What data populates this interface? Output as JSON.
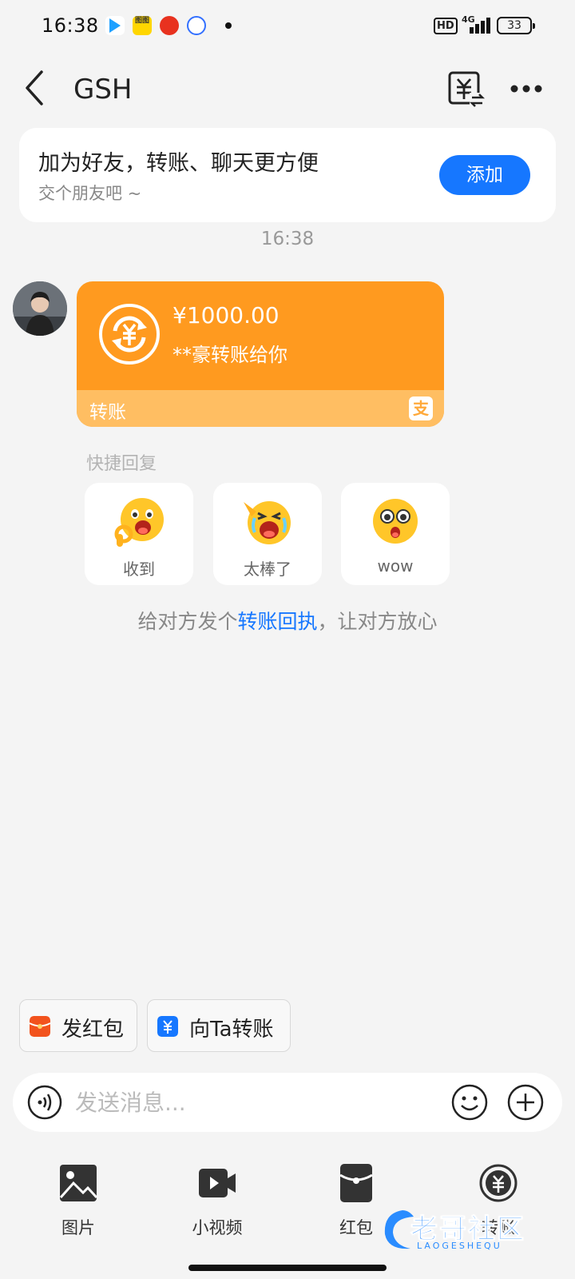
{
  "status_bar": {
    "time": "16:38",
    "notif_2_label": "图图",
    "hd": "HD",
    "network": "4G",
    "battery": "33"
  },
  "header": {
    "title": "GSH"
  },
  "add_friend": {
    "title": "加为好友，转账、聊天更方便",
    "subtitle": "交个朋友吧 ~",
    "button": "添加"
  },
  "chat": {
    "timestamp": "16:38",
    "transfer": {
      "amount": "¥1000.00",
      "description": "**豪转账给你",
      "footer_label": "转账",
      "brand_mark": "支",
      "card_color": "#ff9a1f"
    }
  },
  "quick_reply": {
    "label": "快捷回复",
    "items": [
      {
        "label": "收到",
        "icon": "ok-hand-emoji"
      },
      {
        "label": "太棒了",
        "icon": "cheer-emoji"
      },
      {
        "label": "wow",
        "icon": "wow-emoji"
      }
    ]
  },
  "receipt_tip": {
    "before": "给对方发个",
    "link": "转账回执",
    "after": "，让对方放心"
  },
  "shortcuts": {
    "red_packet": "发红包",
    "transfer": "向Ta转账"
  },
  "input": {
    "placeholder": "发送消息..."
  },
  "toolbar": {
    "items": [
      {
        "label": "图片",
        "icon": "image-icon"
      },
      {
        "label": "小视频",
        "icon": "video-icon"
      },
      {
        "label": "红包",
        "icon": "red-packet-icon"
      },
      {
        "label": "转账",
        "icon": "transfer-icon"
      }
    ]
  },
  "watermark": {
    "text": "老哥社区",
    "sub": "LAOGESHEQU"
  },
  "colors": {
    "accent": "#1677ff",
    "transfer_orange": "#ff9a1f",
    "transfer_footer": "#ffbe62",
    "red_packet": "#f2531d"
  }
}
